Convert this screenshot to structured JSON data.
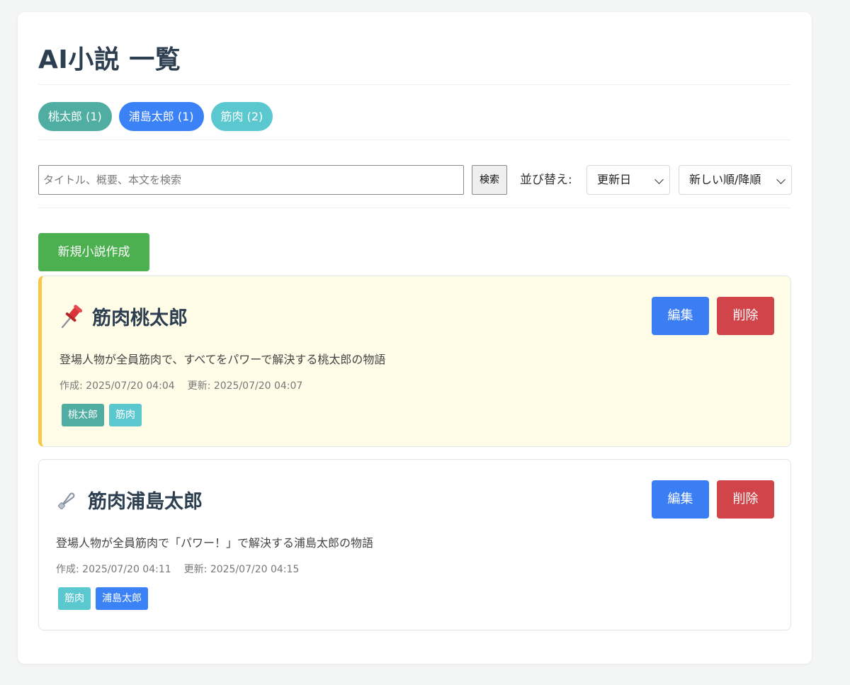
{
  "page": {
    "title": "AI小説 一覧"
  },
  "tag_filters": [
    {
      "label": "桃太郎 (1)",
      "color": "#4fada2"
    },
    {
      "label": "浦島太郎 (1)",
      "color": "#3b82f6"
    },
    {
      "label": "筋肉 (2)",
      "color": "#5bc8d0"
    }
  ],
  "search": {
    "placeholder": "タイトル、概要、本文を検索",
    "value": "",
    "button_label": "検索"
  },
  "sort": {
    "label": "並び替え:",
    "field": "更新日",
    "order": "新しい順/降順"
  },
  "new_button_label": "新規小説作成",
  "colors": {
    "primary_green": "#4caf50",
    "edit_blue": "#3b7ef3",
    "delete_red": "#d0444a",
    "pinned_bg": "#fffce8",
    "pinned_accent": "#f7c948"
  },
  "novels": [
    {
      "icon": "pushpin-icon",
      "title": "筋肉桃太郎",
      "summary": "登場人物が全員筋肉で、すべてをパワーで解決する桃太郎の物語",
      "created": "作成: 2025/07/20 04:04",
      "updated": "更新: 2025/07/20 04:07",
      "pinned": true,
      "tags": [
        {
          "label": "桃太郎",
          "color": "#4fada2"
        },
        {
          "label": "筋肉",
          "color": "#5bc8d0"
        }
      ],
      "edit_label": "編集",
      "delete_label": "削除"
    },
    {
      "icon": "safety-pin-icon",
      "title": "筋肉浦島太郎",
      "summary": "登場人物が全員筋肉で「パワー！」で解決する浦島太郎の物語",
      "created": "作成: 2025/07/20 04:11",
      "updated": "更新: 2025/07/20 04:15",
      "pinned": false,
      "tags": [
        {
          "label": "筋肉",
          "color": "#5bc8d0"
        },
        {
          "label": "浦島太郎",
          "color": "#3b82f6"
        }
      ],
      "edit_label": "編集",
      "delete_label": "削除"
    }
  ]
}
